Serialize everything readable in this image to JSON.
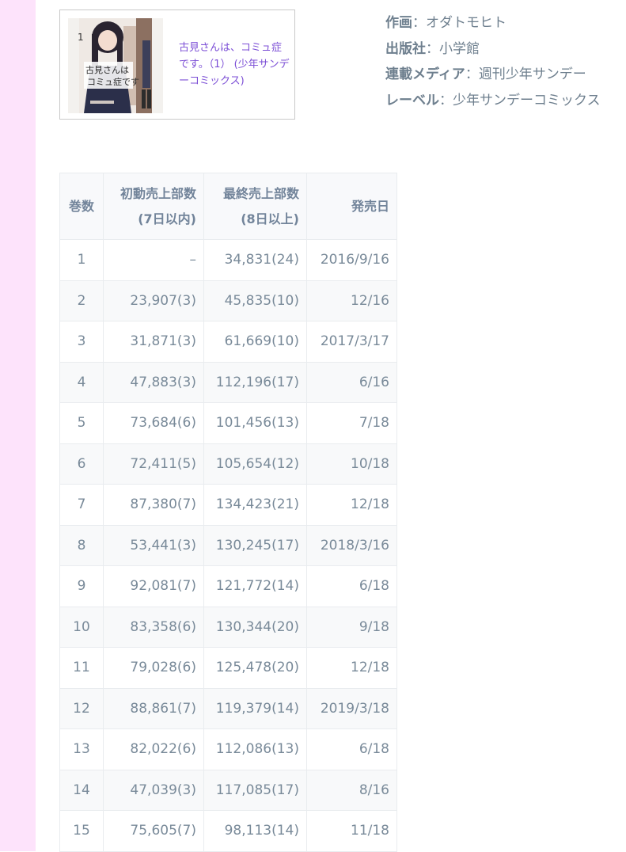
{
  "book": {
    "title_link": "古見さんは、コミュ症です。（1） (少年サンデーコミックス)",
    "cover_title": "古見さんは、コミュ症です。",
    "cover_volume": "1"
  },
  "info": [
    {
      "label": "作画",
      "sep": "：",
      "value": "オダトモヒト"
    },
    {
      "label": "出版社",
      "sep": "：",
      "value": "小学館"
    },
    {
      "label": "連載メディア",
      "sep": "：",
      "value": "週刊少年サンデー"
    },
    {
      "label": "レーベル",
      "sep": "：",
      "value": "少年サンデーコミックス"
    }
  ],
  "table": {
    "headers": {
      "volume": "巻数",
      "first_line1": "初動売上部数",
      "first_line2": "(7日以内)",
      "final_line1": "最終売上部数",
      "final_line2": "(8日以上)",
      "date": "発売日"
    },
    "rows": [
      {
        "volume": "1",
        "first": "–",
        "final": "34,831(24)",
        "date": "2016/9/16"
      },
      {
        "volume": "2",
        "first": "23,907(3)",
        "final": "45,835(10)",
        "date": "12/16"
      },
      {
        "volume": "3",
        "first": "31,871(3)",
        "final": "61,669(10)",
        "date": "2017/3/17"
      },
      {
        "volume": "4",
        "first": "47,883(3)",
        "final": "112,196(17)",
        "date": "6/16"
      },
      {
        "volume": "5",
        "first": "73,684(6)",
        "final": "101,456(13)",
        "date": "7/18"
      },
      {
        "volume": "6",
        "first": "72,411(5)",
        "final": "105,654(12)",
        "date": "10/18"
      },
      {
        "volume": "7",
        "first": "87,380(7)",
        "final": "134,423(21)",
        "date": "12/18"
      },
      {
        "volume": "8",
        "first": "53,441(3)",
        "final": "130,245(17)",
        "date": "2018/3/16"
      },
      {
        "volume": "9",
        "first": "92,081(7)",
        "final": "121,772(14)",
        "date": "6/18"
      },
      {
        "volume": "10",
        "first": "83,358(6)",
        "final": "130,344(20)",
        "date": "9/18"
      },
      {
        "volume": "11",
        "first": "79,028(6)",
        "final": "125,478(20)",
        "date": "12/18"
      },
      {
        "volume": "12",
        "first": "88,861(7)",
        "final": "119,379(14)",
        "date": "2019/3/18"
      },
      {
        "volume": "13",
        "first": "82,022(6)",
        "final": "112,086(13)",
        "date": "6/18"
      },
      {
        "volume": "14",
        "first": "47,039(3)",
        "final": "117,085(17)",
        "date": "8/16"
      },
      {
        "volume": "15",
        "first": "75,605(7)",
        "final": "98,113(14)",
        "date": "11/18"
      }
    ]
  },
  "colors": {
    "sidebar_band": "#fde3fb",
    "link": "#7c4fd6",
    "text": "#798a99",
    "border": "#e9ecef"
  }
}
